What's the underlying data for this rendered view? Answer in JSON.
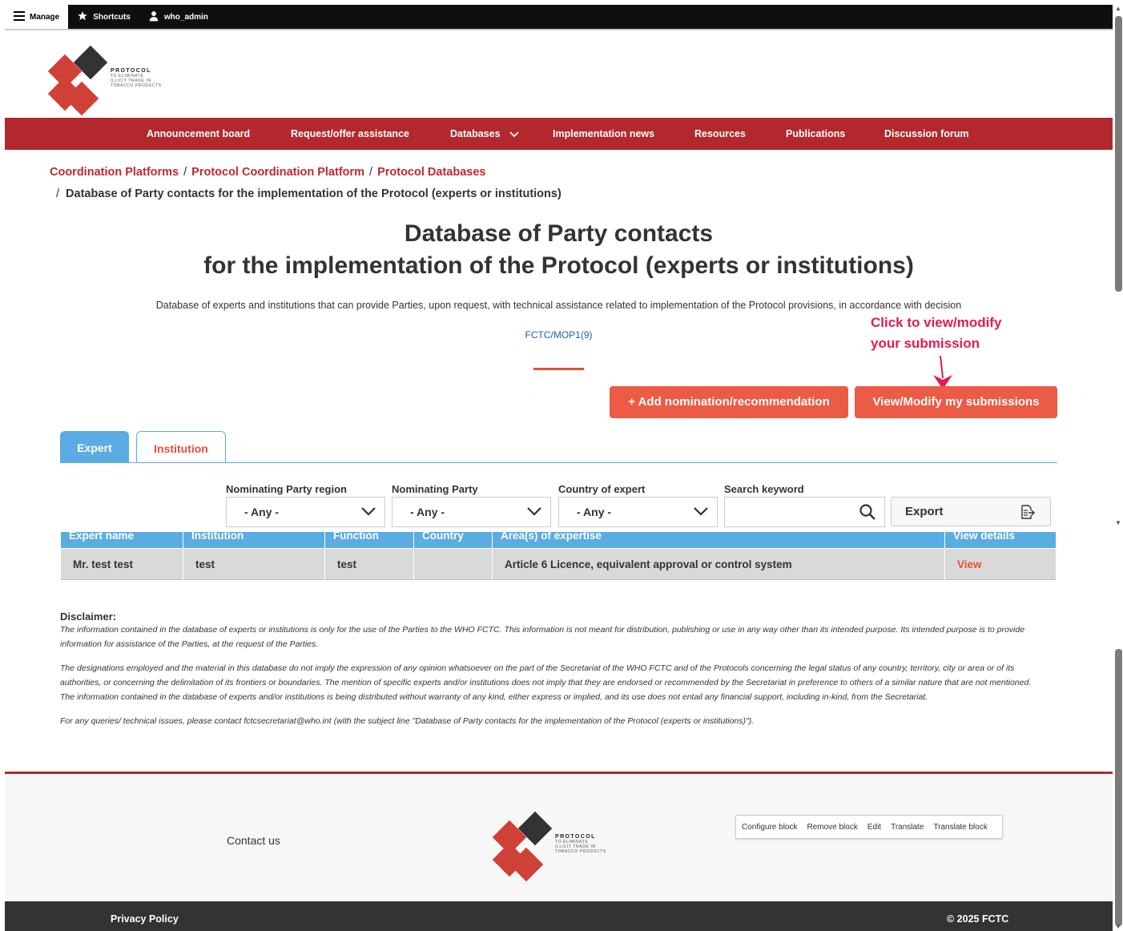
{
  "admin_bar": {
    "manage": "Manage",
    "shortcuts": "Shortcuts",
    "user": "who_admin"
  },
  "logo": {
    "line1": "PROTOCOL",
    "line2": "TO ELIMINATE",
    "line3": "ILLICIT TRADE IN",
    "line4": "TOBACCO PRODUCTS"
  },
  "nav": [
    {
      "label": "Announcement board"
    },
    {
      "label": "Request/offer assistance"
    },
    {
      "label": "Databases"
    },
    {
      "label": "Implementation news"
    },
    {
      "label": "Resources"
    },
    {
      "label": "Publications"
    },
    {
      "label": "Discussion forum"
    }
  ],
  "breadcrumb": {
    "items": [
      "Coordination Platforms",
      "Protocol Coordination Platform",
      "Protocol Databases"
    ],
    "separator": "/",
    "current": "Database of Party contacts for the implementation of the Protocol (experts or institutions)"
  },
  "page": {
    "title_line1": "Database of Party contacts",
    "title_line2": "for the implementation of the Protocol (experts or institutions)",
    "intro": "Database of experts and institutions that can provide Parties, upon request, with technical assistance related to implementation of the Protocol provisions, in accordance with decision",
    "decision_link": "FCTC/MOP1(9)"
  },
  "annotation": {
    "line1": "Click to view/modify",
    "line2": "your submission"
  },
  "actions": {
    "add": "+ Add nomination/recommendation",
    "view_modify": "View/Modify my submissions"
  },
  "tabs": {
    "expert": "Expert",
    "institution": "Institution"
  },
  "filters": {
    "region_label": "Nominating Party region",
    "region_value": "- Any -",
    "party_label": "Nominating Party",
    "party_value": "- Any -",
    "country_label": "Country of expert",
    "country_value": "- Any -",
    "search_label": "Search keyword",
    "search_value": "",
    "export": "Export"
  },
  "table": {
    "headers": [
      "Expert name",
      "Institution",
      "Function",
      "Country",
      "Area(s) of expertise",
      "View details"
    ],
    "rows": [
      [
        "Mr. test test",
        "test",
        "test",
        "",
        "Article 6 Licence, equivalent approval or control system",
        "View"
      ]
    ]
  },
  "disclaimer": {
    "title": "Disclaimer:",
    "p1": "The information contained in the database of experts or institutions is only for the use of the Parties to the WHO FCTC. This information is not meant for distribution, publishing or use in any way other than its intended purpose. Its intended purpose is to provide information for assistance of the Parties, at the request of the Parties.",
    "p2": "The designations employed and the material in this database do not imply the expression of any opinion whatsoever on the part of the Secretariat of the WHO FCTC and of the Protocols concerning the legal status of any country, territory, city or area or of its authorities, or concerning the delimitation of its frontiers or boundaries. The mention of specific experts and/or institutions does not imply that they are endorsed or recommended by the Secretariat in preference to others of a similar nature that are not mentioned. The information contained in the database of experts and/or institutions is being distributed without warranty of any kind, either express or implied, and its use does not entail any financial support, including in-kind, from the Secretariat.",
    "p3": "For any queries/ technical issues, please contact fctcsecretariat@who.int (with the subject line \"Database of Party contacts for the implementation of the Protocol (experts or institutions)\")."
  },
  "footer": {
    "contact": "Contact us",
    "contextual": [
      "Configure block",
      "Remove block",
      "Edit",
      "Translate",
      "Translate block"
    ],
    "privacy": "Privacy Policy",
    "copyright": "© 2025 FCTC"
  },
  "colors": {
    "brand_red": "#b3282d",
    "accent_orange": "#eb5b45",
    "tab_blue": "#5aace3",
    "annotation_pink": "#e8194e"
  }
}
